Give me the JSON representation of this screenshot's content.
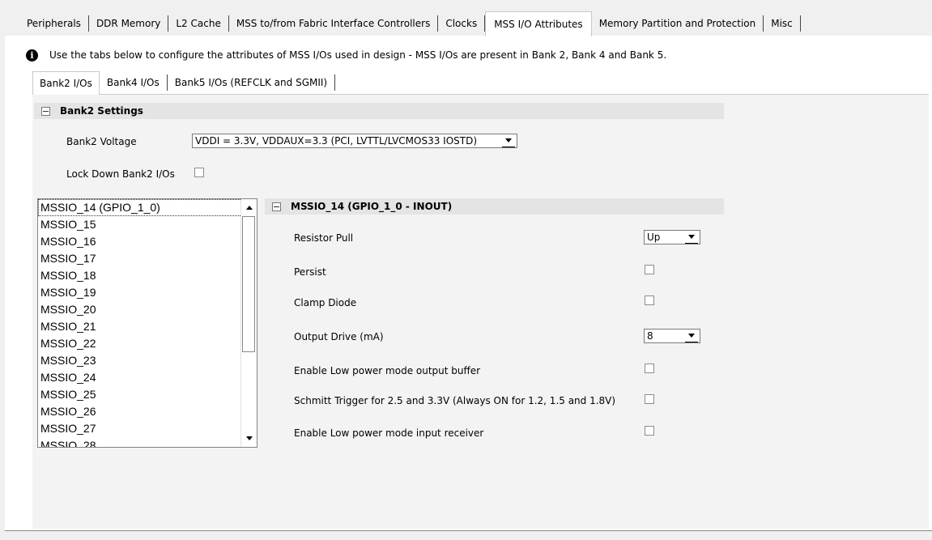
{
  "top_tabs": [
    {
      "label": "Peripherals",
      "active": false
    },
    {
      "label": "DDR Memory",
      "active": false
    },
    {
      "label": "L2 Cache",
      "active": false
    },
    {
      "label": "MSS to/from Fabric Interface Controllers",
      "active": false
    },
    {
      "label": "Clocks",
      "active": false
    },
    {
      "label": "MSS I/O Attributes",
      "active": true
    },
    {
      "label": "Memory Partition and Protection",
      "active": false
    },
    {
      "label": "Misc",
      "active": false
    }
  ],
  "info": {
    "icon": "info-icon",
    "text": "Use the tabs below to configure the attributes of MSS I/Os used in design - MSS I/Os are present in Bank 2, Bank 4 and Bank 5."
  },
  "inner_tabs": [
    {
      "label": "Bank2 I/Os",
      "active": true
    },
    {
      "label": "Bank4 I/Os",
      "active": false
    },
    {
      "label": "Bank5 I/Os (REFCLK and SGMII)",
      "active": false
    }
  ],
  "bank_settings": {
    "header": "Bank2 Settings",
    "voltage_label": "Bank2 Voltage",
    "voltage_value": "VDDI = 3.3V, VDDAUX=3.3 (PCI, LVTTL/LVCMOS33 IOSTD)",
    "lock_label": "Lock Down Bank2 I/Os",
    "lock_checked": false
  },
  "io_list": {
    "items": [
      "MSSIO_14 (GPIO_1_0)",
      "MSSIO_15",
      "MSSIO_16",
      "MSSIO_17",
      "MSSIO_18",
      "MSSIO_19",
      "MSSIO_20",
      "MSSIO_21",
      "MSSIO_22",
      "MSSIO_23",
      "MSSIO_24",
      "MSSIO_25",
      "MSSIO_26",
      "MSSIO_27",
      "MSSIO_28"
    ],
    "selected": "MSSIO_14 (GPIO_1_0)"
  },
  "io_attributes": {
    "header": "MSSIO_14 (GPIO_1_0 - INOUT)",
    "resistor_pull_label": "Resistor Pull",
    "resistor_pull_value": "Up",
    "persist_label": "Persist",
    "clamp_diode_label": "Clamp Diode",
    "output_drive_label": "Output Drive (mA)",
    "output_drive_value": "8",
    "lp_output_label": "Enable Low power mode output buffer",
    "schmitt_label": "Schmitt Trigger for 2.5 and 3.3V (Always ON for 1.2, 1.5 and 1.8V)",
    "lp_input_label": "Enable Low power mode input receiver"
  }
}
